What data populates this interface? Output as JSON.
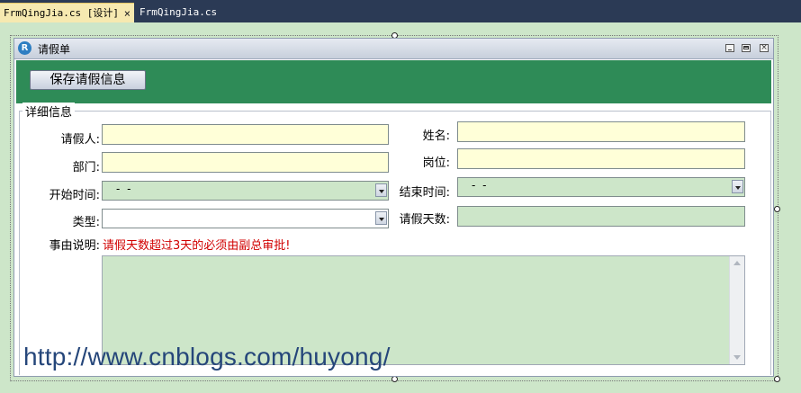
{
  "tabs": [
    {
      "label": "FrmQingJia.cs [设计]",
      "active": true,
      "close_glyph": "×"
    },
    {
      "label": "FrmQingJia.cs",
      "active": false
    }
  ],
  "window": {
    "title": "请假单",
    "logo_text": "R",
    "close_glyph": "×"
  },
  "toolbar": {
    "save_label": "保存请假信息"
  },
  "details": {
    "legend": "详细信息",
    "applicant_label": "请假人:",
    "applicant_value": "",
    "name_label": "姓名:",
    "name_value": "",
    "department_label": "部门:",
    "department_value": "",
    "position_label": "岗位:",
    "position_value": "",
    "start_time_label": "开始时间:",
    "start_time_value": "-   -",
    "end_time_label": "结束时间:",
    "end_time_value": "-   -",
    "type_label": "类型:",
    "type_value": "",
    "days_label": "请假天数:",
    "days_value": "",
    "reason_label": "事由说明:",
    "notice_text": "请假天数超过3天的必须由副总审批!",
    "reason_value": ""
  },
  "watermark": "http://www.cnblogs.com/huyong/",
  "colors": {
    "tabbar_bg": "#2b3a55",
    "toolbar_green": "#2e8b57",
    "input_yellow": "#ffffd8",
    "input_green": "#cde6c9",
    "notice_red": "#d10000",
    "watermark_blue": "#25467a"
  },
  "icons": {
    "tab_close": "close-icon",
    "window_logo": "r-logo-icon",
    "dropdown": "chevron-down-icon"
  }
}
